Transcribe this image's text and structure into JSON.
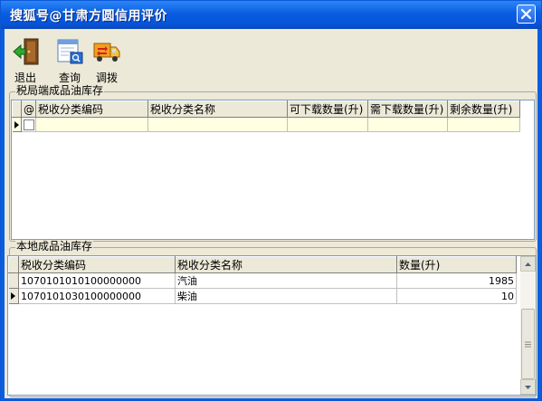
{
  "window": {
    "title": "搜狐号@甘肃方圆信用评价"
  },
  "toolbar": {
    "exit_label": "退出",
    "query_label": "查询",
    "transfer_label": "调拨"
  },
  "tax_section": {
    "title": "税局端成品油库存",
    "columns": [
      "@",
      "税收分类编码",
      "税收分类名称",
      "可下载数量(升)",
      "需下载数量(升)",
      "剩余数量(升)"
    ]
  },
  "local_section": {
    "title": "本地成品油库存",
    "columns": [
      "税收分类编码",
      "税收分类名称",
      "数量(升)"
    ],
    "rows": [
      {
        "code": "1070101010100000000",
        "name": "汽油",
        "qty": "1985"
      },
      {
        "code": "1070101030100000000",
        "name": "柴油",
        "qty": "10"
      }
    ]
  }
}
